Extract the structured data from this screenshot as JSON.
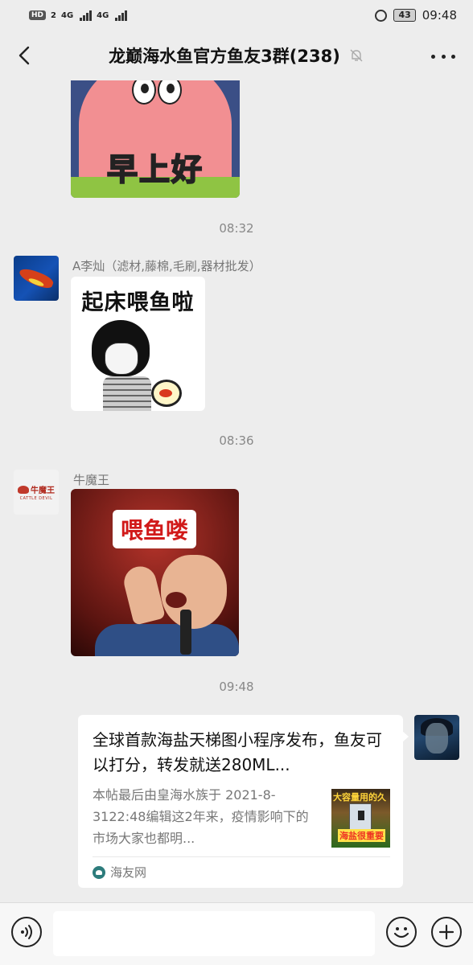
{
  "status_bar": {
    "hd_badge": "HD",
    "sim1_label": "2",
    "network1": "4G",
    "network2": "4G",
    "battery": "43",
    "time": "09:48"
  },
  "header": {
    "title": "龙巅海水鱼官方鱼友3群(238)",
    "muted": true
  },
  "messages": [
    {
      "type": "sticker",
      "sender": "",
      "caption": "早上好"
    },
    {
      "type": "timestamp",
      "text": "08:32"
    },
    {
      "type": "sticker",
      "sender": "A李灿（滤材,藤棉,毛刷,器材批发）",
      "caption": "起床喂鱼啦"
    },
    {
      "type": "timestamp",
      "text": "08:36"
    },
    {
      "type": "sticker",
      "sender": "牛魔王",
      "avatar_text": "牛魔王",
      "avatar_subtext": "CATTLE DEVIL",
      "caption": "喂鱼喽"
    },
    {
      "type": "timestamp",
      "text": "09:48"
    },
    {
      "type": "link_card",
      "sender": "self",
      "title": "全球首款海盐天梯图小程序发布，鱼友可以打分，转发就送280ML...",
      "description": "本帖最后由皇海水族于 2021-8-3122:48编辑这2年来，疫情影响下的市场大家也都明...",
      "thumbnail_text_top": "大容量用的久",
      "thumbnail_text_bottom": "海盐很重要",
      "source": "海友网"
    }
  ],
  "input_bar": {
    "placeholder": "",
    "value": ""
  },
  "icons": {
    "back": "back-chevron-icon",
    "mute": "bell-off-icon",
    "more": "more-dots-icon",
    "voice": "voice-icon",
    "emoji": "emoji-icon",
    "plus": "plus-icon"
  }
}
